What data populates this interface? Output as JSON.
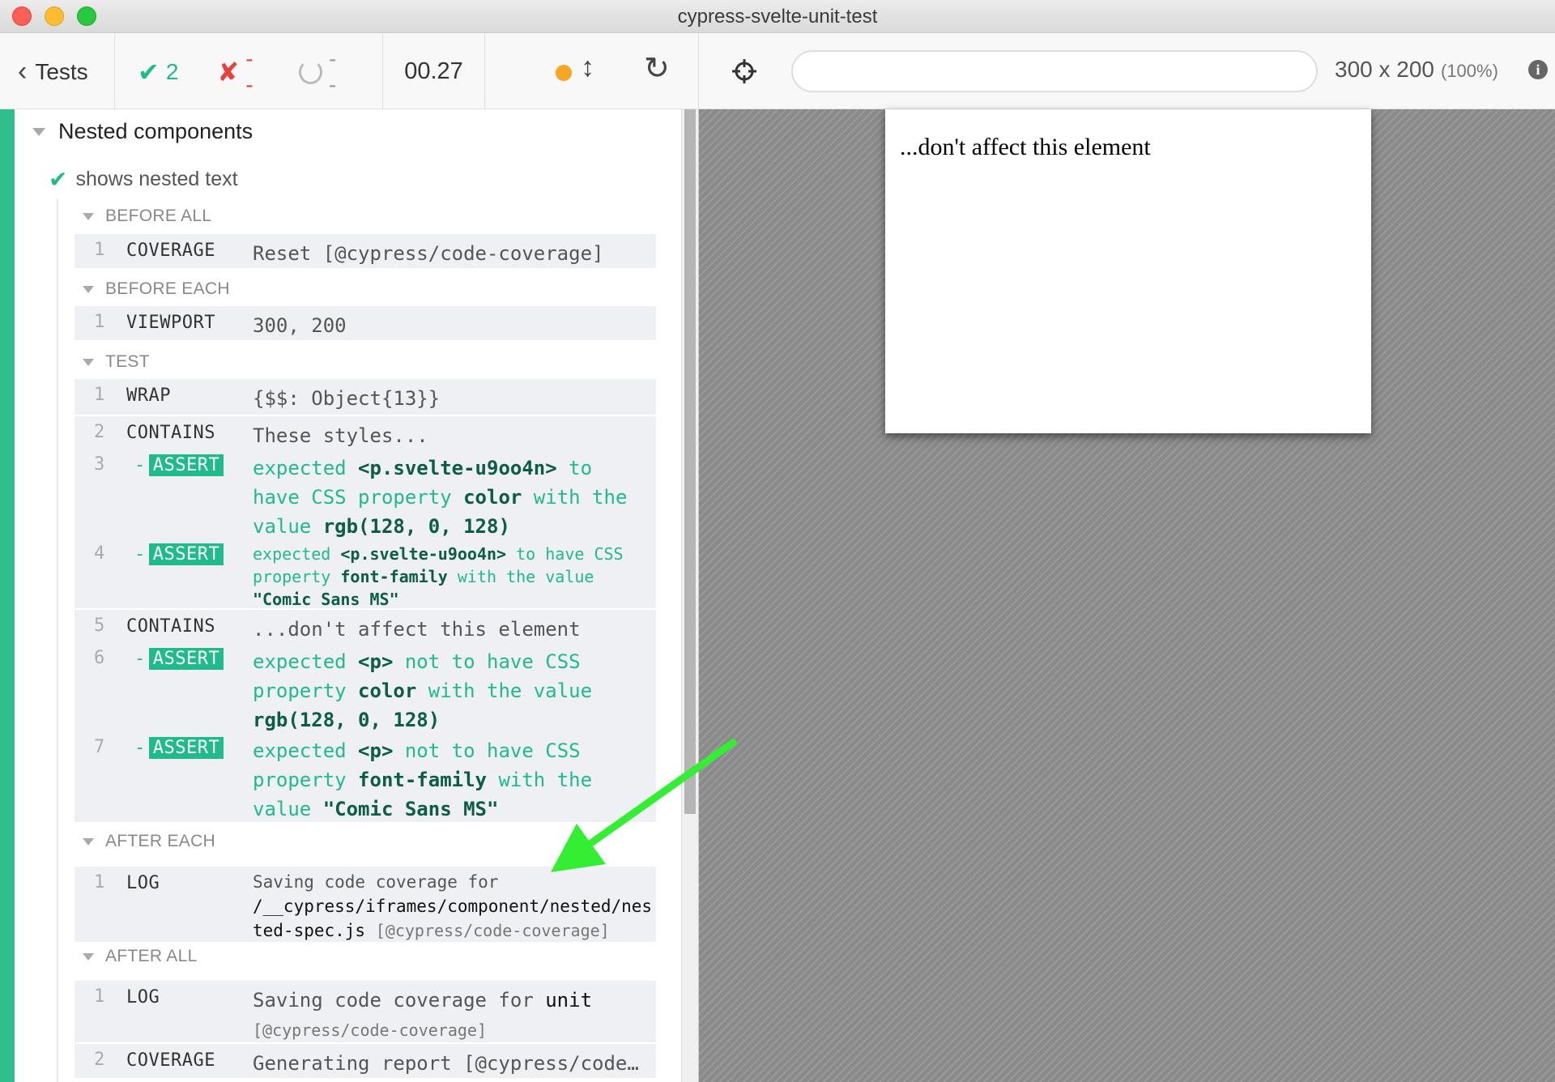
{
  "window": {
    "title": "cypress-svelte-unit-test"
  },
  "toolbar": {
    "back_label": "Tests",
    "passed": "2",
    "failed": "--",
    "pending": "--",
    "duration": "00.27"
  },
  "viewport": {
    "size": "300 x 200",
    "scale": "(100%)",
    "url": ""
  },
  "suite": {
    "title": "Nested components",
    "test_title": "shows nested text",
    "hooks": [
      {
        "title": "BEFORE ALL"
      },
      {
        "title": "BEFORE EACH"
      },
      {
        "title": "TEST"
      },
      {
        "title": "AFTER EACH"
      },
      {
        "title": "AFTER ALL"
      }
    ],
    "commands": {
      "before_all_1": {
        "n": "1",
        "name": "COVERAGE",
        "msg": "Reset [@cypress/code-coverage]"
      },
      "before_each_1": {
        "n": "1",
        "name": "VIEWPORT",
        "msg": "300, 200"
      },
      "test_1": {
        "n": "1",
        "name": "WRAP",
        "msg": "{$$: Object{13}}"
      },
      "test_2": {
        "n": "2",
        "name": "CONTAINS",
        "msg": "These styles..."
      },
      "test_3": {
        "n": "3",
        "badge": "ASSERT",
        "dash": "-",
        "w1": "expected",
        "v1": "<p.svelte-u9oo4n>",
        "w2": "to have CSS property",
        "v2": "color",
        "w3": "with the value",
        "v3": "rgb(128, 0, 128)"
      },
      "test_4": {
        "n": "4",
        "badge": "ASSERT",
        "dash": "-",
        "w1": "expected",
        "v1": "<p.svelte-u9oo4n>",
        "w2": "to have CSS property",
        "v2": "font-family",
        "w3": "with the value",
        "v3": "\"Comic Sans MS\""
      },
      "test_5": {
        "n": "5",
        "name": "CONTAINS",
        "msg": "...don't affect this element"
      },
      "test_6": {
        "n": "6",
        "badge": "ASSERT",
        "dash": "-",
        "w1": "expected",
        "v1": "<p>",
        "w2": "not to have CSS property",
        "v2": "color",
        "w3": "with the value",
        "v3": "rgb(128, 0, 128)"
      },
      "test_7": {
        "n": "7",
        "badge": "ASSERT",
        "dash": "-",
        "w1": "expected",
        "v1": "<p>",
        "w2": "not to have CSS property",
        "v2": "font-family",
        "w3": "with the",
        "w4": "value",
        "v3": "\"Comic Sans MS\""
      },
      "after_each_1": {
        "n": "1",
        "name": "LOG",
        "msg1": "Saving code coverage for",
        "path1": "/__cypress/iframes/component/nested/nes",
        "path2": "ted-spec.js",
        "suffix": "[@cypress/code-coverage]"
      },
      "after_all_1": {
        "n": "1",
        "name": "LOG",
        "msg1": "Saving code coverage for",
        "bold": "unit",
        "suffix": "[@cypress/code-coverage]"
      },
      "after_all_2": {
        "n": "2",
        "name": "COVERAGE",
        "msg": "Generating report [@cypress/code…"
      }
    }
  },
  "aut": {
    "text": "...don't affect this element"
  },
  "colors": {
    "pass": "#1fbb8a",
    "fail": "#e8403c",
    "running": "#f5a623",
    "annotation_arrow": "#33ee33"
  },
  "icons": [
    "chevron-left-icon",
    "check-icon",
    "x-icon",
    "spinner-icon",
    "status-dot-icon",
    "resize-arrows-icon",
    "reload-icon",
    "crosshair-icon",
    "info-icon",
    "triangle-down-icon"
  ]
}
